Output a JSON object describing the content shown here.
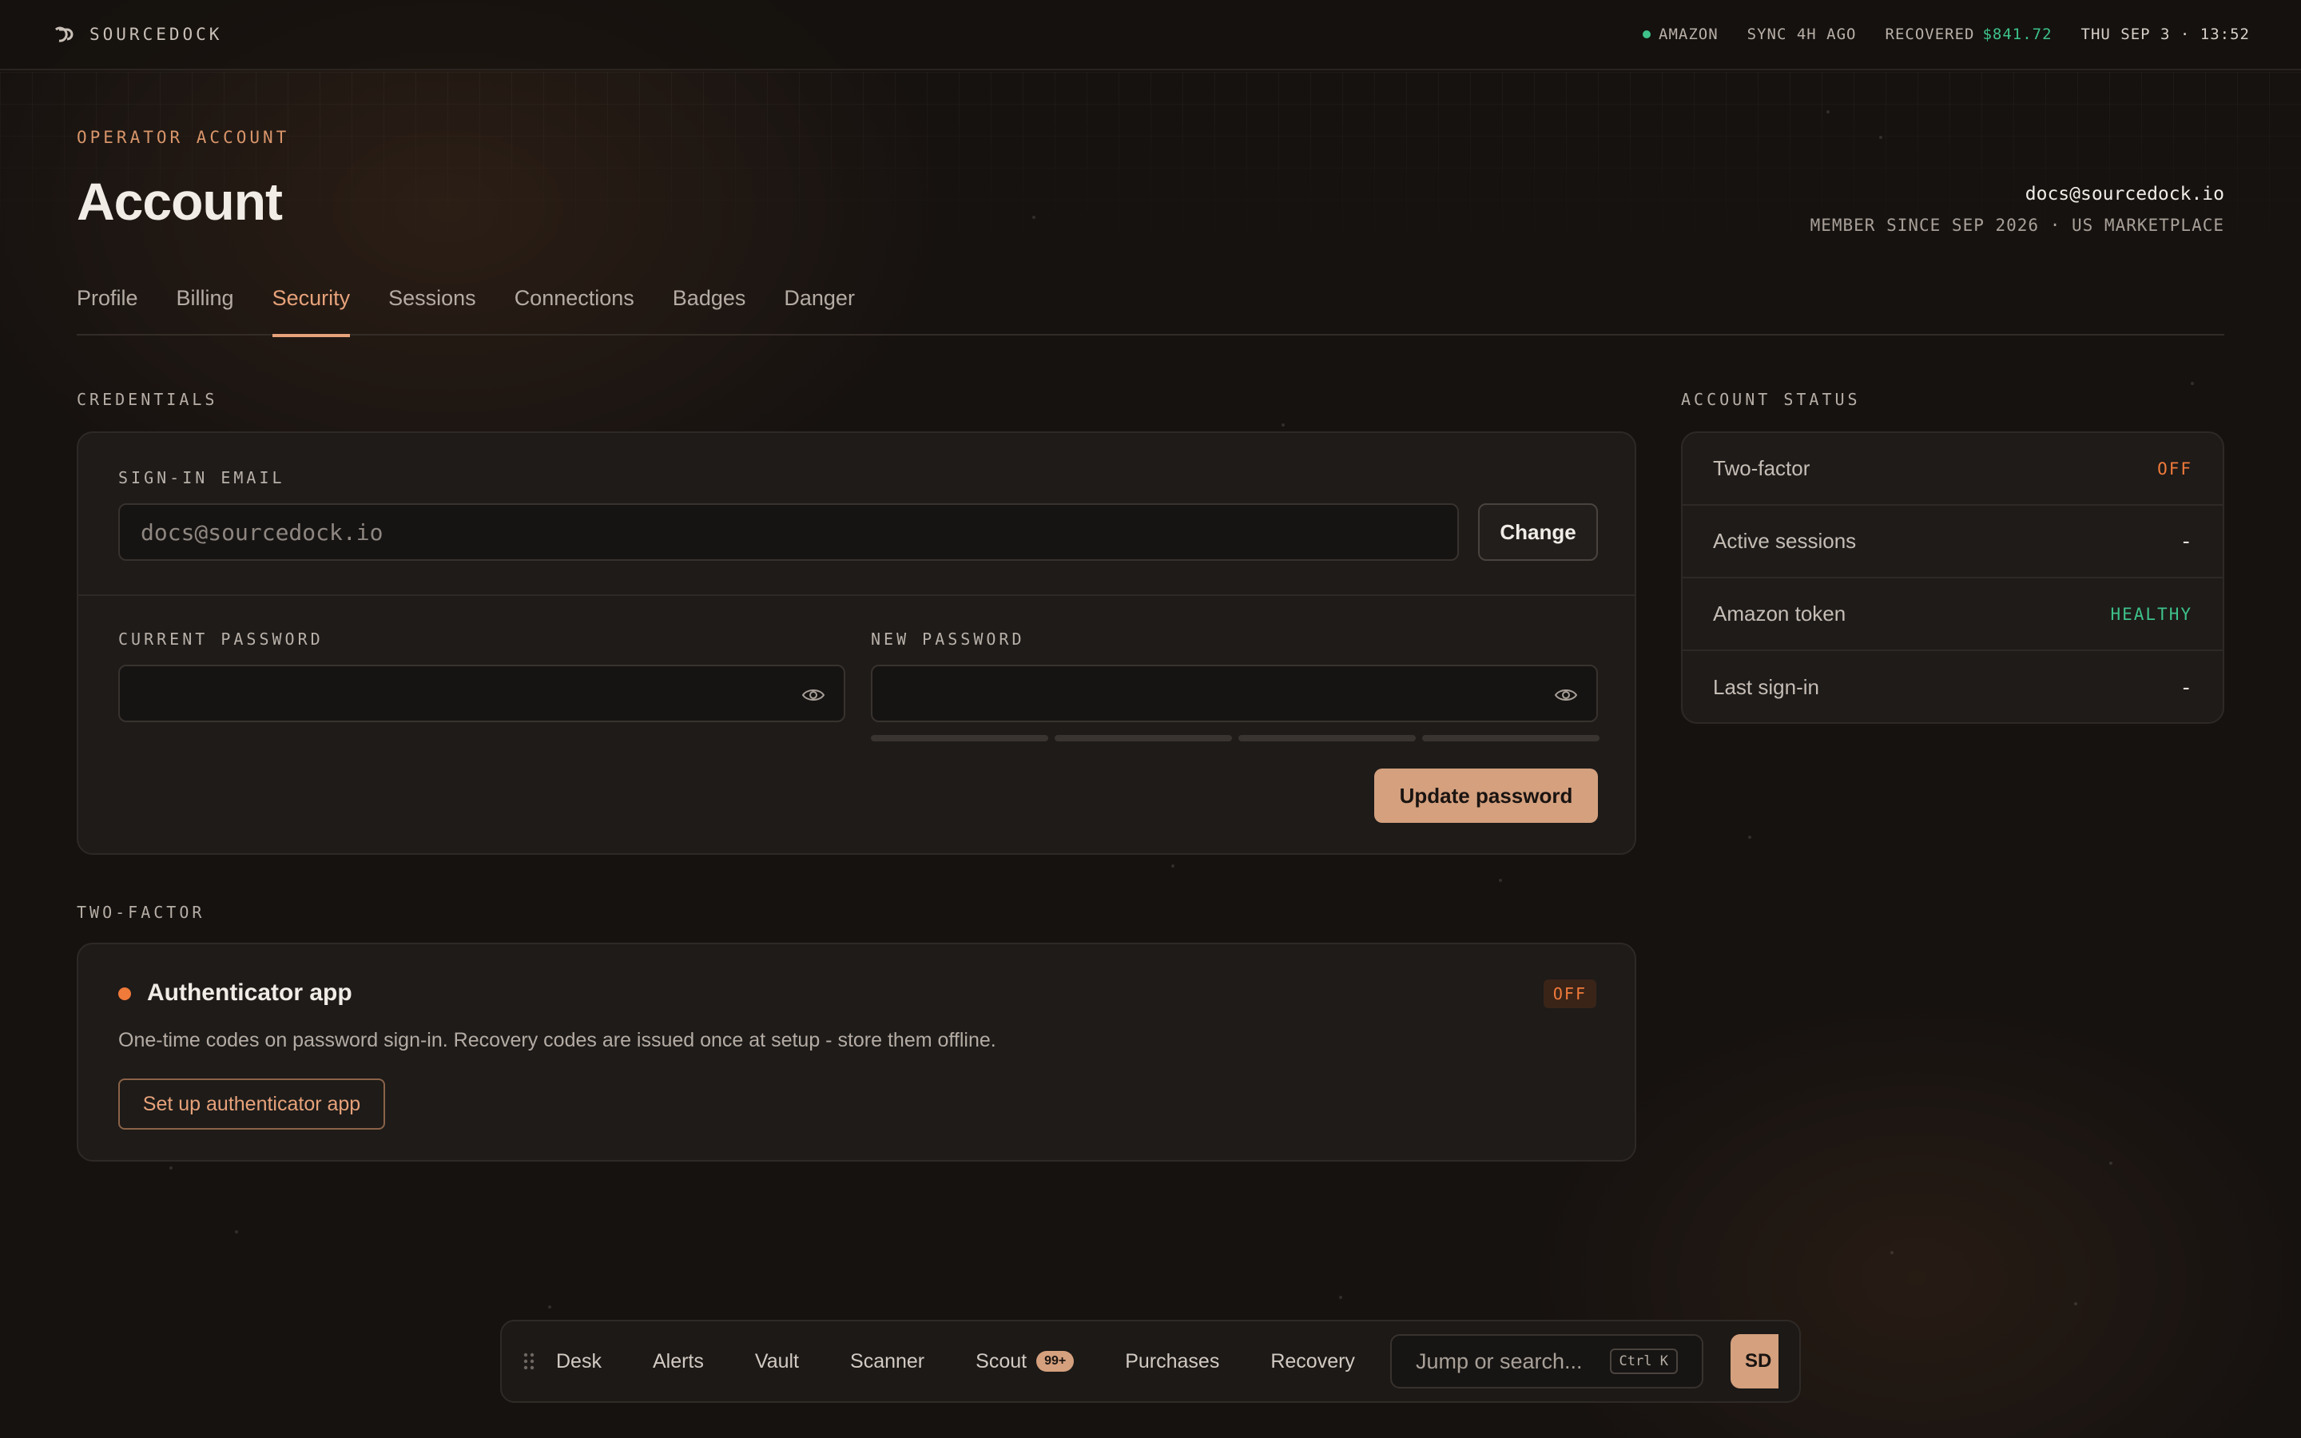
{
  "topbar": {
    "brand": "SOURCEDOCK",
    "marketplace": "AMAZON",
    "sync": "SYNC 4H AGO",
    "recovered_label": "RECOVERED",
    "recovered_value": "$841.72",
    "clock": "THU SEP 3 · 13:52"
  },
  "header": {
    "eyebrow": "OPERATOR ACCOUNT",
    "title": "Account",
    "email": "docs@sourcedock.io",
    "member_since": "MEMBER SINCE SEP 2026 · US MARKETPLACE"
  },
  "tabs": [
    {
      "label": "Profile"
    },
    {
      "label": "Billing"
    },
    {
      "label": "Security",
      "active": true
    },
    {
      "label": "Sessions"
    },
    {
      "label": "Connections"
    },
    {
      "label": "Badges"
    },
    {
      "label": "Danger"
    }
  ],
  "credentials": {
    "section_label": "CREDENTIALS",
    "email_label": "SIGN-IN EMAIL",
    "email_value": "docs@sourcedock.io",
    "change_label": "Change",
    "current_password_label": "CURRENT PASSWORD",
    "new_password_label": "NEW PASSWORD",
    "update_label": "Update password"
  },
  "status": {
    "section_label": "ACCOUNT STATUS",
    "rows": [
      {
        "label": "Two-factor",
        "value": "OFF"
      },
      {
        "label": "Active sessions",
        "value": "-"
      },
      {
        "label": "Amazon token",
        "value": "HEALTHY"
      },
      {
        "label": "Last sign-in",
        "value": "-"
      }
    ]
  },
  "two_factor": {
    "section_label": "TWO-FACTOR",
    "title": "Authenticator app",
    "badge": "OFF",
    "description": "One-time codes on password sign-in. Recovery codes are issued once at setup - store them offline.",
    "setup_label": "Set up authenticator app"
  },
  "dock": {
    "items": [
      {
        "label": "Desk"
      },
      {
        "label": "Alerts"
      },
      {
        "label": "Vault"
      },
      {
        "label": "Scanner"
      },
      {
        "label": "Scout",
        "badge": "99+"
      },
      {
        "label": "Purchases"
      },
      {
        "label": "Recovery"
      }
    ],
    "search_placeholder": "Jump or search...",
    "shortcut": "Ctrl K",
    "avatar": "SD"
  },
  "colors": {
    "accent": "#e6a27a",
    "success": "#3ec28a",
    "warning": "#f07a3a",
    "background": "#161210"
  }
}
